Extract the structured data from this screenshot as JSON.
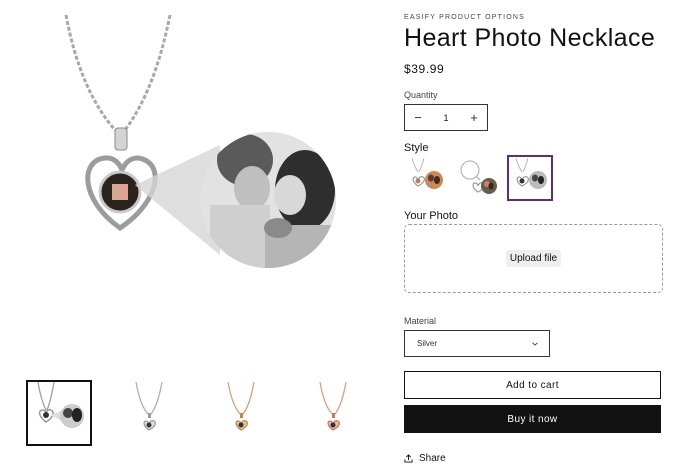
{
  "product": {
    "vendor": "EASIFY PRODUCT OPTIONS",
    "title": "Heart Photo Necklace",
    "price": "$39.99"
  },
  "quantity": {
    "label": "Quantity",
    "value": "1",
    "decrement": "−",
    "increment": "+"
  },
  "style": {
    "label": "Style",
    "selected_index": 2,
    "options": [
      "heart-necklace-color-photo",
      "heart-keychain-color-photo",
      "heart-necklace-bw-photo"
    ]
  },
  "photo": {
    "label": "Your Photo",
    "upload_label": "Upload file"
  },
  "material": {
    "label": "Material",
    "value": "Silver"
  },
  "actions": {
    "add_to_cart": "Add to cart",
    "buy_now": "Buy it now",
    "share": "Share"
  },
  "gallery": {
    "thumbnails": [
      "silver-photo-necklace",
      "silver-necklace",
      "gold-necklace",
      "rose-gold-necklace"
    ],
    "active_index": 0
  },
  "colors": {
    "selected_outline": "#5b2d7d",
    "primary_button": "#121212"
  }
}
